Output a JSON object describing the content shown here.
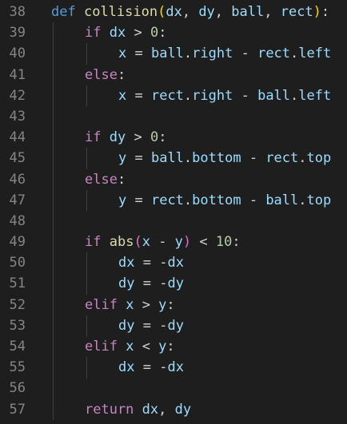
{
  "editor": {
    "colors": {
      "background": "#1e1e1e",
      "line_number": "#858585",
      "keyword": "#569cd6",
      "control": "#c586c0",
      "function": "#dcdcaa",
      "variable": "#9cdcfe",
      "number": "#b5cea8",
      "operator": "#d4d4d4",
      "bracket_gold": "#ffd700",
      "bracket_pink": "#da70d6"
    },
    "lines": [
      {
        "num": "38",
        "indent": 0,
        "tokens": [
          {
            "t": "def",
            "c": "kw"
          },
          {
            "t": " ",
            "c": "op"
          },
          {
            "t": "collision",
            "c": "fn"
          },
          {
            "t": "(",
            "c": "paren1"
          },
          {
            "t": "dx",
            "c": "var"
          },
          {
            "t": ", ",
            "c": "op"
          },
          {
            "t": "dy",
            "c": "var"
          },
          {
            "t": ", ",
            "c": "op"
          },
          {
            "t": "ball",
            "c": "var"
          },
          {
            "t": ", ",
            "c": "op"
          },
          {
            "t": "rect",
            "c": "var"
          },
          {
            "t": ")",
            "c": "paren1"
          },
          {
            "t": ":",
            "c": "op"
          }
        ]
      },
      {
        "num": "39",
        "indent": 1,
        "tokens": [
          {
            "t": "if",
            "c": "ctl"
          },
          {
            "t": " ",
            "c": "op"
          },
          {
            "t": "dx",
            "c": "var"
          },
          {
            "t": " > ",
            "c": "op"
          },
          {
            "t": "0",
            "c": "num"
          },
          {
            "t": ":",
            "c": "op"
          }
        ]
      },
      {
        "num": "40",
        "indent": 2,
        "tokens": [
          {
            "t": "x",
            "c": "var"
          },
          {
            "t": " = ",
            "c": "op"
          },
          {
            "t": "ball",
            "c": "var"
          },
          {
            "t": ".",
            "c": "op"
          },
          {
            "t": "right",
            "c": "var"
          },
          {
            "t": " - ",
            "c": "op"
          },
          {
            "t": "rect",
            "c": "var"
          },
          {
            "t": ".",
            "c": "op"
          },
          {
            "t": "left",
            "c": "var"
          }
        ]
      },
      {
        "num": "41",
        "indent": 1,
        "tokens": [
          {
            "t": "else",
            "c": "ctl"
          },
          {
            "t": ":",
            "c": "op"
          }
        ]
      },
      {
        "num": "42",
        "indent": 2,
        "tokens": [
          {
            "t": "x",
            "c": "var"
          },
          {
            "t": " = ",
            "c": "op"
          },
          {
            "t": "rect",
            "c": "var"
          },
          {
            "t": ".",
            "c": "op"
          },
          {
            "t": "right",
            "c": "var"
          },
          {
            "t": " - ",
            "c": "op"
          },
          {
            "t": "ball",
            "c": "var"
          },
          {
            "t": ".",
            "c": "op"
          },
          {
            "t": "left",
            "c": "var"
          }
        ]
      },
      {
        "num": "43",
        "indent": 0,
        "tokens": []
      },
      {
        "num": "44",
        "indent": 1,
        "tokens": [
          {
            "t": "if",
            "c": "ctl"
          },
          {
            "t": " ",
            "c": "op"
          },
          {
            "t": "dy",
            "c": "var"
          },
          {
            "t": " > ",
            "c": "op"
          },
          {
            "t": "0",
            "c": "num"
          },
          {
            "t": ":",
            "c": "op"
          }
        ]
      },
      {
        "num": "45",
        "indent": 2,
        "tokens": [
          {
            "t": "y",
            "c": "var"
          },
          {
            "t": " = ",
            "c": "op"
          },
          {
            "t": "ball",
            "c": "var"
          },
          {
            "t": ".",
            "c": "op"
          },
          {
            "t": "bottom",
            "c": "var"
          },
          {
            "t": " - ",
            "c": "op"
          },
          {
            "t": "rect",
            "c": "var"
          },
          {
            "t": ".",
            "c": "op"
          },
          {
            "t": "top",
            "c": "var"
          }
        ]
      },
      {
        "num": "46",
        "indent": 1,
        "tokens": [
          {
            "t": "else",
            "c": "ctl"
          },
          {
            "t": ":",
            "c": "op"
          }
        ]
      },
      {
        "num": "47",
        "indent": 2,
        "tokens": [
          {
            "t": "y",
            "c": "var"
          },
          {
            "t": " = ",
            "c": "op"
          },
          {
            "t": "rect",
            "c": "var"
          },
          {
            "t": ".",
            "c": "op"
          },
          {
            "t": "bottom",
            "c": "var"
          },
          {
            "t": " - ",
            "c": "op"
          },
          {
            "t": "ball",
            "c": "var"
          },
          {
            "t": ".",
            "c": "op"
          },
          {
            "t": "top",
            "c": "var"
          }
        ]
      },
      {
        "num": "48",
        "indent": 0,
        "tokens": []
      },
      {
        "num": "49",
        "indent": 1,
        "tokens": [
          {
            "t": "if",
            "c": "ctl"
          },
          {
            "t": " ",
            "c": "op"
          },
          {
            "t": "abs",
            "c": "fn"
          },
          {
            "t": "(",
            "c": "paren2"
          },
          {
            "t": "x",
            "c": "var"
          },
          {
            "t": " - ",
            "c": "op"
          },
          {
            "t": "y",
            "c": "var"
          },
          {
            "t": ")",
            "c": "paren2"
          },
          {
            "t": " < ",
            "c": "op"
          },
          {
            "t": "10",
            "c": "num"
          },
          {
            "t": ":",
            "c": "op"
          }
        ]
      },
      {
        "num": "50",
        "indent": 2,
        "tokens": [
          {
            "t": "dx",
            "c": "var"
          },
          {
            "t": " = ",
            "c": "op"
          },
          {
            "t": "-",
            "c": "op"
          },
          {
            "t": "dx",
            "c": "var"
          }
        ]
      },
      {
        "num": "51",
        "indent": 2,
        "tokens": [
          {
            "t": "dy",
            "c": "var"
          },
          {
            "t": " = ",
            "c": "op"
          },
          {
            "t": "-",
            "c": "op"
          },
          {
            "t": "dy",
            "c": "var"
          }
        ]
      },
      {
        "num": "52",
        "indent": 1,
        "tokens": [
          {
            "t": "elif",
            "c": "ctl"
          },
          {
            "t": " ",
            "c": "op"
          },
          {
            "t": "x",
            "c": "var"
          },
          {
            "t": " > ",
            "c": "op"
          },
          {
            "t": "y",
            "c": "var"
          },
          {
            "t": ":",
            "c": "op"
          }
        ]
      },
      {
        "num": "53",
        "indent": 2,
        "tokens": [
          {
            "t": "dy",
            "c": "var"
          },
          {
            "t": " = ",
            "c": "op"
          },
          {
            "t": "-",
            "c": "op"
          },
          {
            "t": "dy",
            "c": "var"
          }
        ]
      },
      {
        "num": "54",
        "indent": 1,
        "tokens": [
          {
            "t": "elif",
            "c": "ctl"
          },
          {
            "t": " ",
            "c": "op"
          },
          {
            "t": "x",
            "c": "var"
          },
          {
            "t": " < ",
            "c": "op"
          },
          {
            "t": "y",
            "c": "var"
          },
          {
            "t": ":",
            "c": "op"
          }
        ]
      },
      {
        "num": "55",
        "indent": 2,
        "tokens": [
          {
            "t": "dx",
            "c": "var"
          },
          {
            "t": " = ",
            "c": "op"
          },
          {
            "t": "-",
            "c": "op"
          },
          {
            "t": "dx",
            "c": "var"
          }
        ]
      },
      {
        "num": "56",
        "indent": 0,
        "tokens": []
      },
      {
        "num": "57",
        "indent": 1,
        "tokens": [
          {
            "t": "return",
            "c": "ctl"
          },
          {
            "t": " ",
            "c": "op"
          },
          {
            "t": "dx",
            "c": "var"
          },
          {
            "t": ", ",
            "c": "op"
          },
          {
            "t": "dy",
            "c": "var"
          }
        ]
      }
    ]
  }
}
